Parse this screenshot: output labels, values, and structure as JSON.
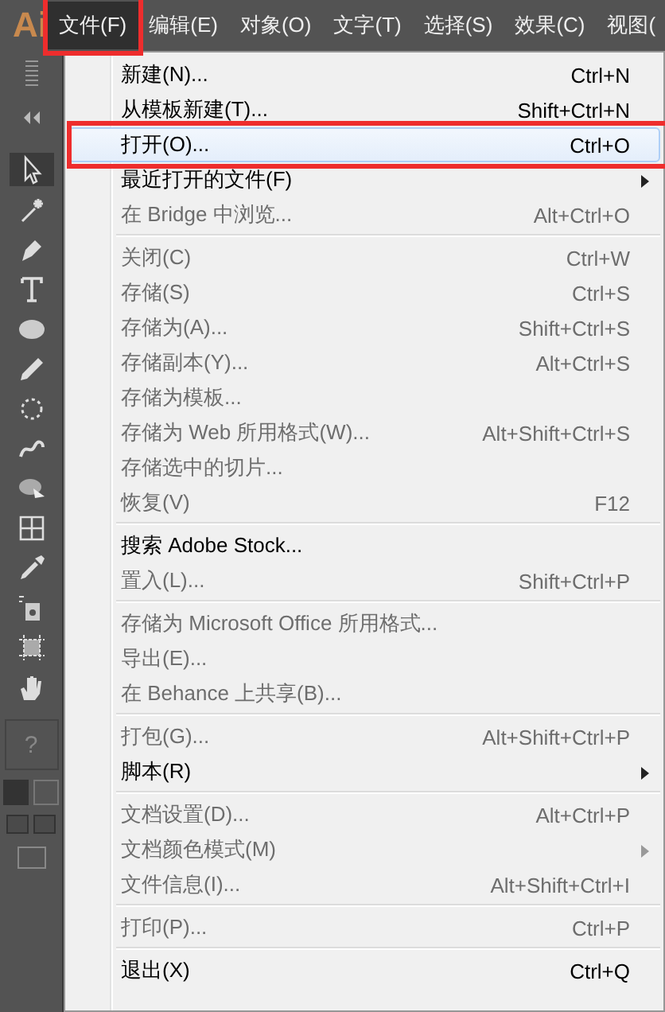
{
  "app_logo": "Ai",
  "menubar": [
    {
      "label": "文件(F)",
      "selected": true,
      "annotated": true
    },
    {
      "label": "编辑(E)",
      "selected": false,
      "annotated": false
    },
    {
      "label": "对象(O)",
      "selected": false,
      "annotated": false
    },
    {
      "label": "文字(T)",
      "selected": false,
      "annotated": false
    },
    {
      "label": "选择(S)",
      "selected": false,
      "annotated": false
    },
    {
      "label": "效果(C)",
      "selected": false,
      "annotated": false
    },
    {
      "label": "视图(",
      "selected": false,
      "annotated": false
    }
  ],
  "tools": [
    {
      "selected": true
    },
    {
      "selected": false
    },
    {
      "selected": false
    },
    {
      "selected": false
    },
    {
      "selected": false
    },
    {
      "selected": false
    },
    {
      "selected": false
    },
    {
      "selected": false
    },
    {
      "selected": false
    },
    {
      "selected": false
    },
    {
      "selected": false
    },
    {
      "selected": false
    },
    {
      "selected": false
    },
    {
      "selected": false
    }
  ],
  "tool_help": "?",
  "menu": {
    "sections": [
      [
        {
          "label": "新建(N)...",
          "shortcut": "Ctrl+N",
          "disabled": false,
          "highlighted": false,
          "submenu": false,
          "annotated": false
        },
        {
          "label": "从模板新建(T)...",
          "shortcut": "Shift+Ctrl+N",
          "disabled": false,
          "highlighted": false,
          "submenu": false,
          "annotated": false
        },
        {
          "label": "打开(O)...",
          "shortcut": "Ctrl+O",
          "disabled": false,
          "highlighted": true,
          "submenu": false,
          "annotated": true
        },
        {
          "label": "最近打开的文件(F)",
          "disabled": false,
          "highlighted": false,
          "submenu": true,
          "annotated": false
        },
        {
          "label": "在 Bridge 中浏览...",
          "shortcut": "Alt+Ctrl+O",
          "disabled": true,
          "highlighted": false,
          "submenu": false,
          "annotated": false
        }
      ],
      [
        {
          "label": "关闭(C)",
          "shortcut": "Ctrl+W",
          "disabled": true,
          "highlighted": false,
          "submenu": false,
          "annotated": false
        },
        {
          "label": "存储(S)",
          "shortcut": "Ctrl+S",
          "disabled": true,
          "highlighted": false,
          "submenu": false,
          "annotated": false
        },
        {
          "label": "存储为(A)...",
          "shortcut": "Shift+Ctrl+S",
          "disabled": true,
          "highlighted": false,
          "submenu": false,
          "annotated": false
        },
        {
          "label": "存储副本(Y)...",
          "shortcut": "Alt+Ctrl+S",
          "disabled": true,
          "highlighted": false,
          "submenu": false,
          "annotated": false
        },
        {
          "label": "存储为模板...",
          "disabled": true,
          "highlighted": false,
          "submenu": false,
          "annotated": false
        },
        {
          "label": "存储为 Web 所用格式(W)...",
          "shortcut": "Alt+Shift+Ctrl+S",
          "disabled": true,
          "highlighted": false,
          "submenu": false,
          "annotated": false
        },
        {
          "label": "存储选中的切片...",
          "disabled": true,
          "highlighted": false,
          "submenu": false,
          "annotated": false
        },
        {
          "label": "恢复(V)",
          "shortcut": "F12",
          "disabled": true,
          "highlighted": false,
          "submenu": false,
          "annotated": false
        }
      ],
      [
        {
          "label": "搜索 Adobe Stock...",
          "disabled": false,
          "highlighted": false,
          "submenu": false,
          "annotated": false
        },
        {
          "label": "置入(L)...",
          "shortcut": "Shift+Ctrl+P",
          "disabled": true,
          "highlighted": false,
          "submenu": false,
          "annotated": false
        }
      ],
      [
        {
          "label": "存储为 Microsoft Office 所用格式...",
          "disabled": true,
          "highlighted": false,
          "submenu": false,
          "annotated": false
        },
        {
          "label": "导出(E)...",
          "disabled": true,
          "highlighted": false,
          "submenu": false,
          "annotated": false
        },
        {
          "label": "在 Behance 上共享(B)...",
          "disabled": true,
          "highlighted": false,
          "submenu": false,
          "annotated": false
        }
      ],
      [
        {
          "label": "打包(G)...",
          "shortcut": "Alt+Shift+Ctrl+P",
          "disabled": true,
          "highlighted": false,
          "submenu": false,
          "annotated": false
        },
        {
          "label": "脚本(R)",
          "disabled": false,
          "highlighted": false,
          "submenu": true,
          "annotated": false
        }
      ],
      [
        {
          "label": "文档设置(D)...",
          "shortcut": "Alt+Ctrl+P",
          "disabled": true,
          "highlighted": false,
          "submenu": false,
          "annotated": false
        },
        {
          "label": "文档颜色模式(M)",
          "disabled": true,
          "highlighted": false,
          "submenu": true,
          "annotated": false
        },
        {
          "label": "文件信息(I)...",
          "shortcut": "Alt+Shift+Ctrl+I",
          "disabled": true,
          "highlighted": false,
          "submenu": false,
          "annotated": false
        }
      ],
      [
        {
          "label": "打印(P)...",
          "shortcut": "Ctrl+P",
          "disabled": true,
          "highlighted": false,
          "submenu": false,
          "annotated": false
        }
      ],
      [
        {
          "label": "退出(X)",
          "shortcut": "Ctrl+Q",
          "disabled": false,
          "highlighted": false,
          "submenu": false,
          "annotated": false
        }
      ]
    ]
  }
}
